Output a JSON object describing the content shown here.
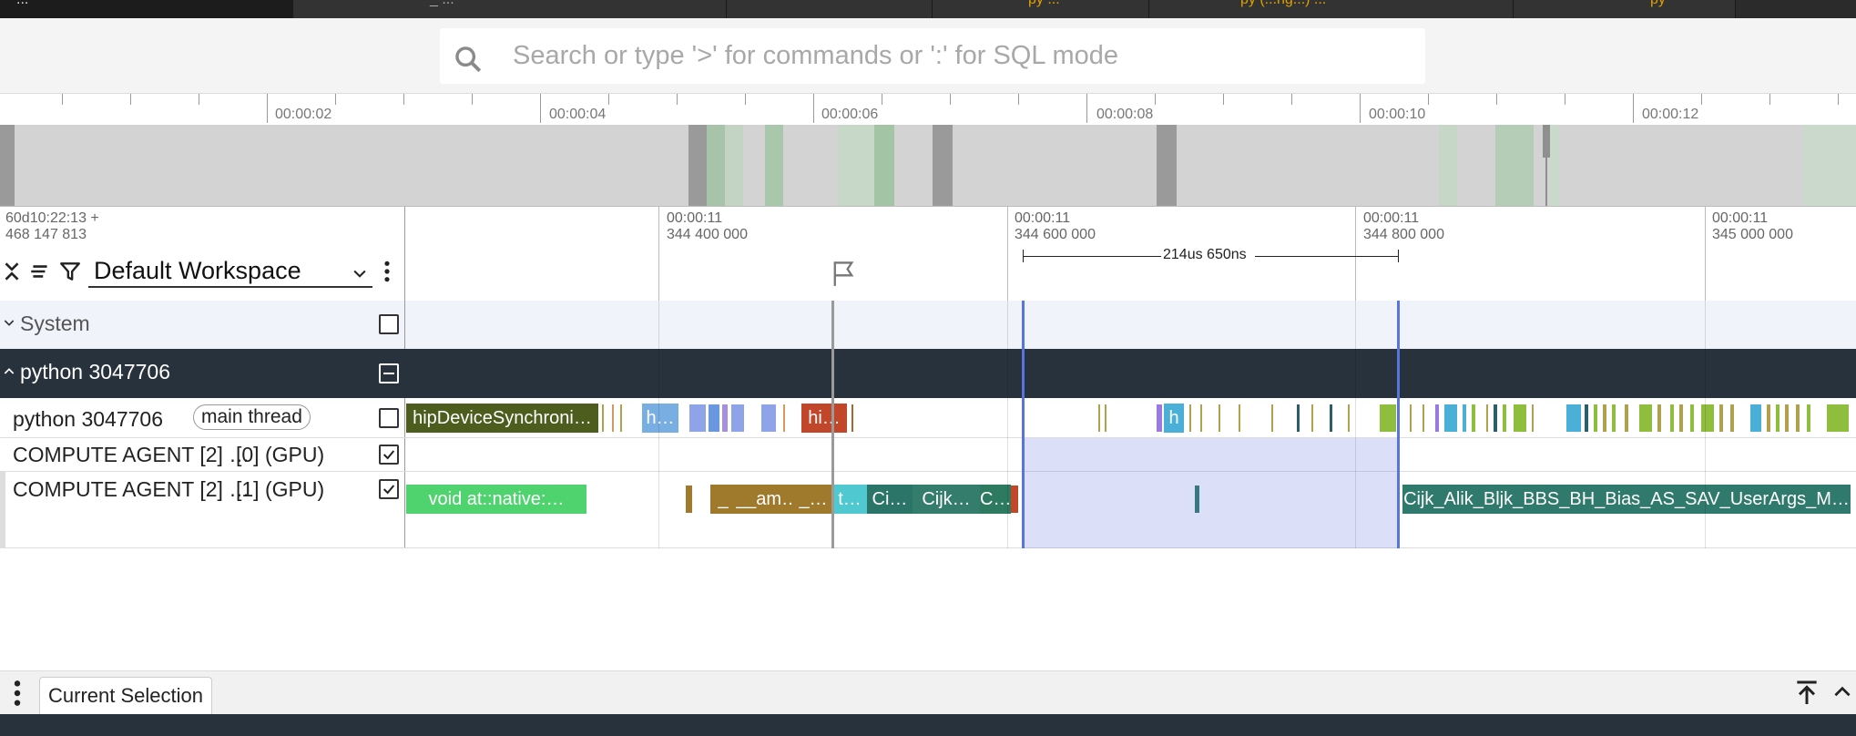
{
  "tabs": [
    {
      "label": "..."
    },
    {
      "label": "_ ..."
    },
    {
      "label": "py ..."
    },
    {
      "label": "py (...ng...) ..."
    },
    {
      "label": "py"
    }
  ],
  "search": {
    "placeholder": "Search or type '>' for commands or ':' for SQL mode",
    "value": ""
  },
  "overview": {
    "tick_labels": [
      "00:00:02",
      "00:00:04",
      "00:00:06",
      "00:00:08",
      "00:00:10",
      "00:00:12"
    ]
  },
  "timeline": {
    "origin_line1": "60d10:22:13 +",
    "origin_line2": "468 147 813",
    "ticks": [
      {
        "line1": "00:00:11",
        "line2": "344 400 000"
      },
      {
        "line1": "00:00:11",
        "line2": "344 600 000"
      },
      {
        "line1": "00:00:11",
        "line2": "344 800 000"
      },
      {
        "line1": "00:00:11",
        "line2": "345 000 000"
      }
    ],
    "measure_label": "214us 650ns"
  },
  "workspace": {
    "selected": "Default Workspace"
  },
  "tracks": {
    "system": {
      "label": "System",
      "checked": false
    },
    "process": {
      "label": "python 3047706",
      "state": "partial"
    },
    "thread_main": {
      "label": "python 3047706",
      "badge": "main thread",
      "checked": false
    },
    "gpu0": {
      "label": "COMPUTE AGENT [2] …",
      "sublabel": "[0] (GPU)",
      "checked": true
    },
    "gpu1": {
      "label": "COMPUTE AGENT [2] …",
      "sublabel": "[1] (GPU)",
      "checked": true
    }
  },
  "slices": {
    "main": [
      {
        "name": "hipDeviceSynchroni…",
        "color": "#4c5d1e"
      },
      {
        "name": "h…",
        "color": "#79aee3"
      },
      {
        "name": "hi…",
        "color": "#c2462a"
      },
      {
        "name": "h",
        "color": "#4ab0d8"
      }
    ],
    "gpu1": [
      {
        "name": "void at::native:…",
        "color": "#4fd36e"
      },
      {
        "name": "_",
        "color": "#a07a2c"
      },
      {
        "name": "__am…",
        "color": "#a07a2c"
      },
      {
        "name": "_…",
        "color": "#a07a2c"
      },
      {
        "name": "t…",
        "color": "#4fc8d0"
      },
      {
        "name": "Ci…",
        "color": "#2b7468"
      },
      {
        "name": "Cijk…",
        "color": "#347d6d"
      },
      {
        "name": "C…",
        "color": "#2d7a60"
      },
      {
        "name": "Cijk_Alik_Bljk_BBS_BH_Bias_AS_SAV_UserArgs_M…",
        "color": "#2f7a6c"
      }
    ]
  },
  "bottom": {
    "tab_label": "Current Selection"
  },
  "colors": {
    "selection": "#3a5fd6",
    "dark_row": "#28323c",
    "accent": "#e0a000"
  }
}
